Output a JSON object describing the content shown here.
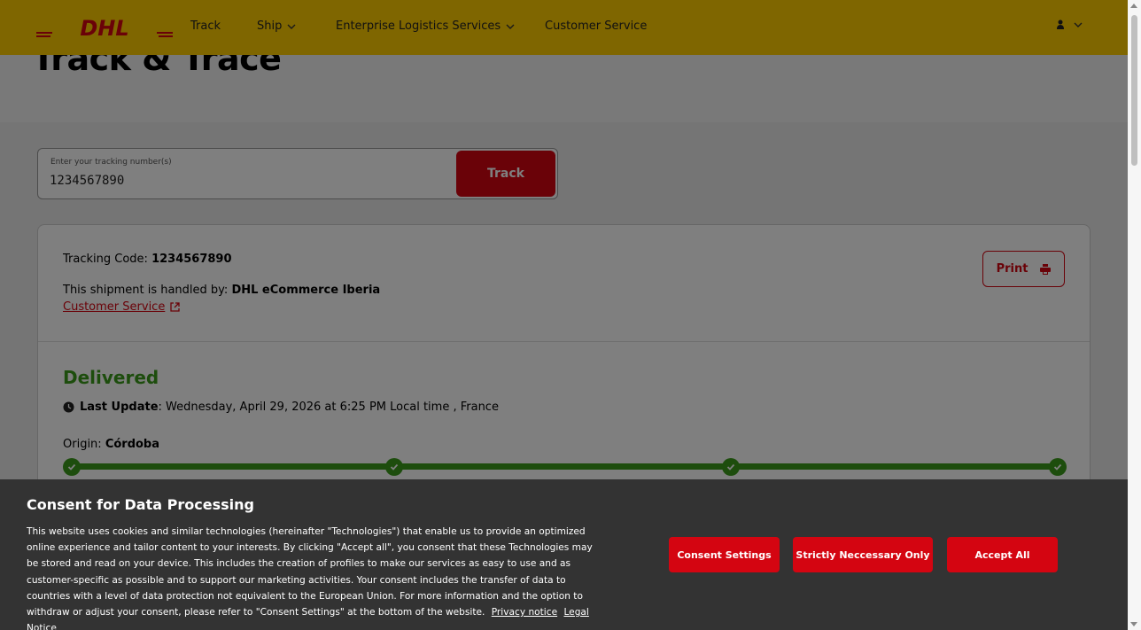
{
  "header": {
    "logo_text": "DHL",
    "nav": [
      {
        "label": "Track"
      },
      {
        "label": "Ship"
      },
      {
        "label": "Enterprise Logistics Services"
      },
      {
        "label": "Customer Service"
      }
    ]
  },
  "hero": {
    "title": "Track & Trace"
  },
  "search": {
    "label": "Enter your tracking number(s)",
    "value": "1234567890",
    "button": "Track"
  },
  "shipment": {
    "tracking_label": "Tracking Code:",
    "tracking_code": "1234567890",
    "handled_label": "This shipment is handled by:",
    "handler": "DHL eCommerce Iberia",
    "cs_link": "Customer Service",
    "print": "Print",
    "status": "Delivered",
    "last_update_label": "Last Update",
    "last_update_value": ": Wednesday, April 29, 2026 at 6:25 PM Local time , France",
    "origin_label": "Origin:",
    "origin": "Córdoba"
  },
  "consent": {
    "title": "Consent for Data Processing",
    "body": "This website uses cookies and similar technologies (hereinafter \"Technologies\") that enable us to provide an optimized online experience and tailor content to your interests. By clicking \"Accept all\", you consent that these Technologies may be stored and read on your device. This includes the creation of profiles to make our services as easy to use and as customer-specific as possible and to support our marketing activities. Your consent includes the transfer of data to countries with a level of data protection not equivalent to the European Union. For more information and the option to withdraw or adjust your consent, please refer to \"Consent Settings\" at the bottom of the website.",
    "privacy_link": "Privacy notice",
    "legal_link": "Legal Notice",
    "buttons": {
      "settings": "Consent Settings",
      "necessary": "Strictly Neccessary Only",
      "accept": "Accept All"
    }
  },
  "colors": {
    "brand_yellow": "#FFCC00",
    "brand_red": "#D40511",
    "success": "#3b9b1b"
  }
}
